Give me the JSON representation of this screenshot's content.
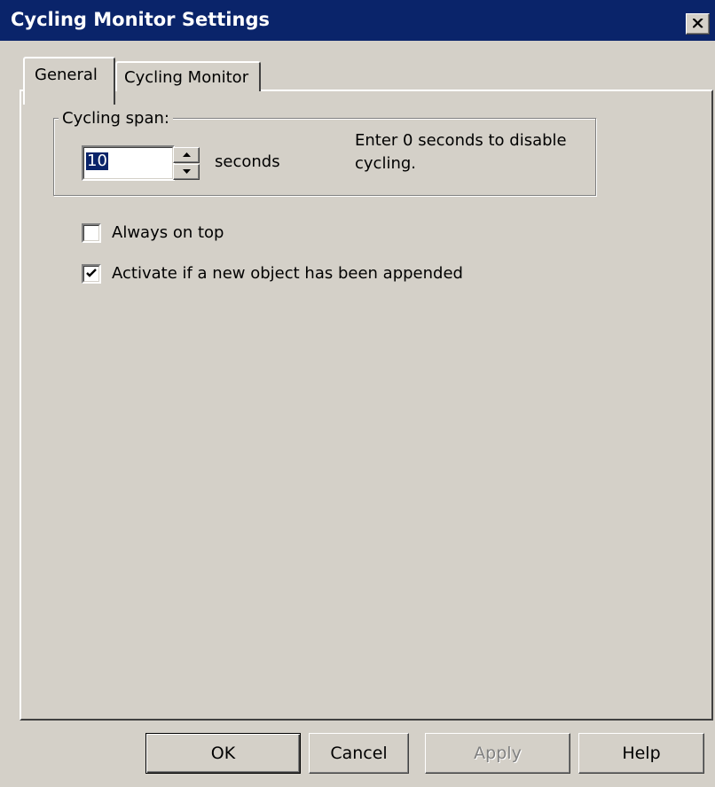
{
  "window": {
    "title": "Cycling Monitor Settings",
    "colors": {
      "titlebar": "#0a246a",
      "face": "#d4d0c8",
      "selection": "#0a246a"
    }
  },
  "tabs": [
    {
      "label": "General",
      "selected": true
    },
    {
      "label": "Cycling Monitor",
      "selected": false
    }
  ],
  "general": {
    "group_label": "Cycling span:",
    "span_value": "10",
    "span_unit": "seconds",
    "hint": "Enter 0 seconds to disable cycling.",
    "checkboxes": [
      {
        "label": "Always on top",
        "checked": false
      },
      {
        "label": "Activate if a new object has been appended",
        "checked": true
      }
    ]
  },
  "buttons": {
    "ok": "OK",
    "cancel": "Cancel",
    "apply": "Apply",
    "help": "Help"
  },
  "icons": {
    "close": "close-icon",
    "spin_up": "arrow-up-icon",
    "spin_down": "arrow-down-icon",
    "check": "checkmark-icon"
  }
}
